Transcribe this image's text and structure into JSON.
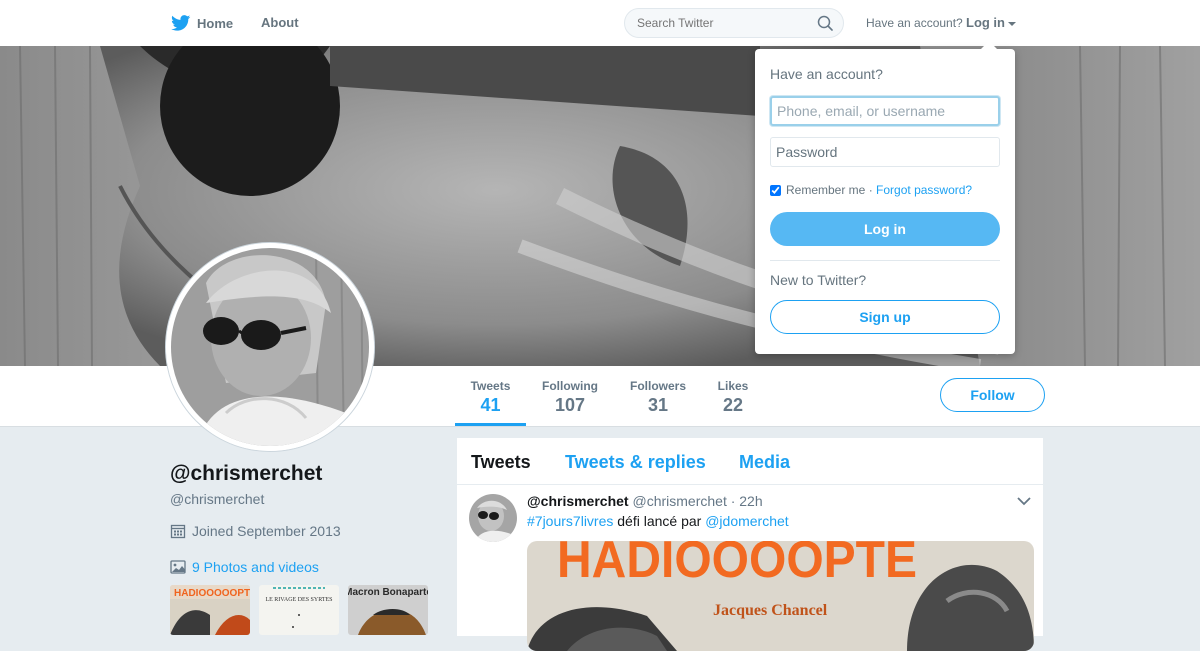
{
  "colors": {
    "brand": "#1da1f2",
    "background": "#e6ecf0",
    "muted": "#657786"
  },
  "nav": {
    "home_label": "Home",
    "about_label": "About",
    "search_placeholder": "Search Twitter",
    "account_prompt": "Have an account?",
    "login_label": "Log in",
    "icons": [
      "twitter-bird-icon",
      "search-icon",
      "chevron-down-icon"
    ]
  },
  "profile": {
    "screen_name": "@chrismerchet",
    "handle": "@chrismerchet",
    "joined": "Joined September 2013",
    "photos_link": "9 Photos and videos",
    "stats": [
      {
        "label": "Tweets",
        "value": "41"
      },
      {
        "label": "Following",
        "value": "107"
      },
      {
        "label": "Followers",
        "value": "31"
      },
      {
        "label": "Likes",
        "value": "22"
      }
    ],
    "follow_label": "Follow"
  },
  "thumbnails": [
    {
      "caption": "HADIOOOOOPTE"
    },
    {
      "caption": "LE RIVAGE DES SYRTES"
    },
    {
      "caption": "Macron Bonaparte"
    }
  ],
  "timeline": {
    "tabs": [
      "Tweets",
      "Tweets & replies",
      "Media"
    ],
    "active_tab": "Tweets",
    "tweet": {
      "name": "@chrismerchet",
      "handle": "@chrismerchet",
      "time": "· 22h",
      "hashtag": "#7jours7livres",
      "text_middle": "défi lancé par",
      "mention": "@jdomerchet",
      "media_title": "HADIOOOOPTE",
      "media_author": "Jacques Chancel"
    }
  },
  "login_dropdown": {
    "title": "Have an account?",
    "username_placeholder": "Phone, email, or username",
    "password_placeholder": "Password",
    "remember_label": "Remember me",
    "separator": "·",
    "forgot_label": "Forgot password?",
    "remember_checked": true,
    "login_button": "Log in",
    "new_prompt": "New to Twitter?",
    "signup_button": "Sign up"
  }
}
